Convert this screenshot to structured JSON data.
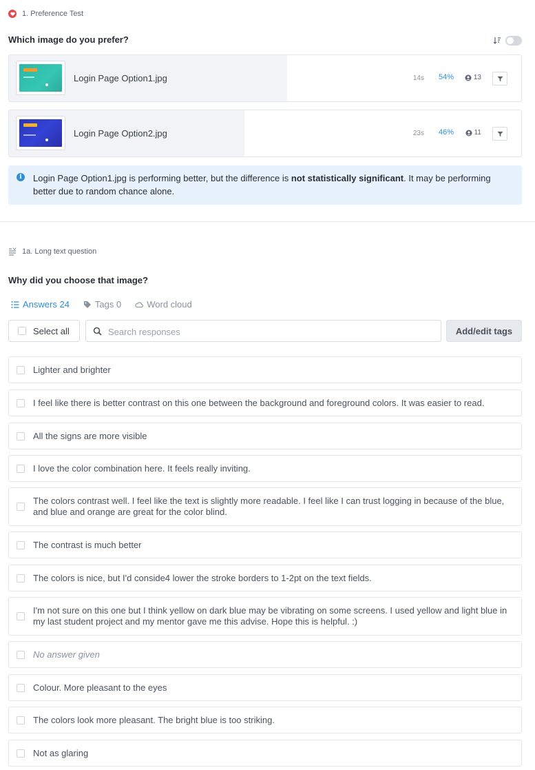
{
  "section1": {
    "header": "1. Preference Test",
    "question": "Which image do you prefer?",
    "options": [
      {
        "name": "Login Page Option1.jpg",
        "time": "14s",
        "percent": "54%",
        "share": 0.54,
        "count": "13"
      },
      {
        "name": "Login Page Option2.jpg",
        "time": "23s",
        "percent": "46%",
        "share": 0.46,
        "count": "11"
      }
    ],
    "info": {
      "prefix": "Login Page Option1.jpg is performing better, but the difference is ",
      "bold": "not statistically significant",
      "suffix": ". It may be performing better due to random chance alone."
    }
  },
  "section2": {
    "header": "1a. Long text question",
    "question": "Why did you choose that image?",
    "tabs": {
      "answers": "Answers 24",
      "tags": "Tags 0",
      "wordcloud": "Word cloud"
    },
    "select_all": "Select all",
    "search_placeholder": "Search responses",
    "tags_button": "Add/edit tags",
    "answers": [
      "Lighter and brighter",
      "I feel like there is better contrast on this one between the background and foreground colors. It was easier to read.",
      "All the signs are more visible",
      "I love the color combination here. It feels really inviting.",
      "The colors contrast well. I feel like the text is slightly more readable. I feel like I can trust logging in because of the blue, and blue and orange are great for the color blind.",
      "The contrast is much better",
      "The colors is nice, but I'd conside4 lower the stroke borders to 1-2pt on the text fields.",
      "I'm not sure on this one but I think yellow on dark blue may be vibrating on some screens. I used yellow and light blue in my last student project and my mentor gave me this advise. Hope this is helpful. :)",
      "No answer given",
      "Colour. More pleasant to the eyes",
      "The colors look more pleasant. The bright blue is too striking.",
      "Not as glaring"
    ],
    "empty_answer": "No answer given"
  },
  "colors": {
    "accent": "#2e8fd6",
    "heart": "#e24b4b",
    "info_bg": "#e7f2fc"
  }
}
